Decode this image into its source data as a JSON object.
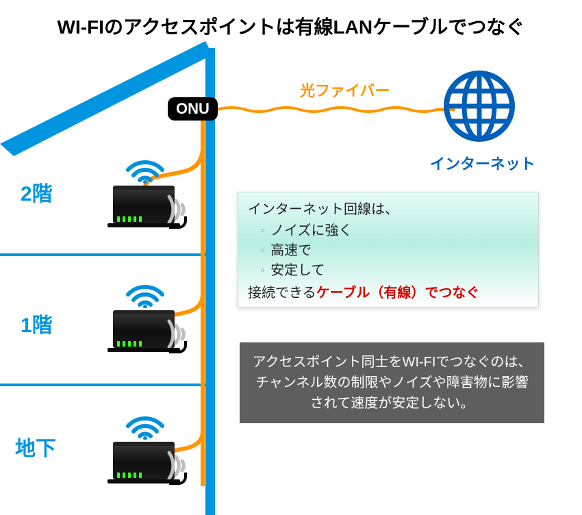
{
  "title": "WI-FIのアクセスポイントは有線LANケーブルでつなぐ",
  "floors": {
    "f2": "2階",
    "f1": "1階",
    "b1": "地下"
  },
  "onu": "ONU",
  "fiber_label": "光ファイバー",
  "internet_label": "インターネット",
  "info": {
    "lead": "インターネット回線は、",
    "items": [
      "ノイズに強く",
      "高速で",
      "安定して"
    ],
    "foot_prefix": "接続できる",
    "foot_highlight": "ケーブル（有線）でつなぐ"
  },
  "note": "アクセスポイント同士をWI-FIでつなぐのは、チャンネル数の制限やノイズや障害物に影響されて速度が安定しない。",
  "colors": {
    "blue": "#0095e0",
    "orange": "#ff9500",
    "red": "#d80000"
  }
}
